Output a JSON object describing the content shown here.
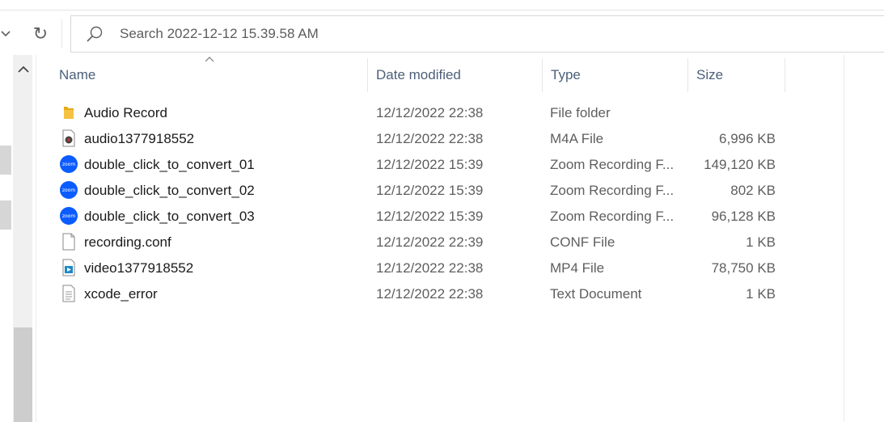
{
  "toolbar": {
    "refresh_glyph": "↻",
    "search_placeholder": "Search 2022-12-12 15.39.58 AM"
  },
  "columns": {
    "name": "Name",
    "date_modified": "Date modified",
    "type": "Type",
    "size": "Size"
  },
  "files": [
    {
      "name": "Audio Record",
      "date": "12/12/2022 22:38",
      "type": "File folder",
      "size": "",
      "icon": "folder-icon"
    },
    {
      "name": "audio1377918552",
      "date": "12/12/2022 22:38",
      "type": "M4A File",
      "size": "6,996 KB",
      "icon": "audio-file-icon"
    },
    {
      "name": "double_click_to_convert_01",
      "date": "12/12/2022 15:39",
      "type": "Zoom Recording F...",
      "size": "149,120 KB",
      "icon": "zoom-icon"
    },
    {
      "name": "double_click_to_convert_02",
      "date": "12/12/2022 15:39",
      "type": "Zoom Recording F...",
      "size": "802 KB",
      "icon": "zoom-icon"
    },
    {
      "name": "double_click_to_convert_03",
      "date": "12/12/2022 15:39",
      "type": "Zoom Recording F...",
      "size": "96,128 KB",
      "icon": "zoom-icon"
    },
    {
      "name": "recording.conf",
      "date": "12/12/2022 22:39",
      "type": "CONF File",
      "size": "1 KB",
      "icon": "blank-file-icon"
    },
    {
      "name": "video1377918552",
      "date": "12/12/2022 22:38",
      "type": "MP4 File",
      "size": "78,750 KB",
      "icon": "video-file-icon"
    },
    {
      "name": "xcode_error",
      "date": "12/12/2022 22:38",
      "type": "Text Document",
      "size": "1 KB",
      "icon": "text-file-icon"
    }
  ],
  "zoom_badge_text": "zoom",
  "colors": {
    "header_text": "#4c607a",
    "zoom_blue": "#0b5cff",
    "folder_yellow": "#f5c242"
  }
}
